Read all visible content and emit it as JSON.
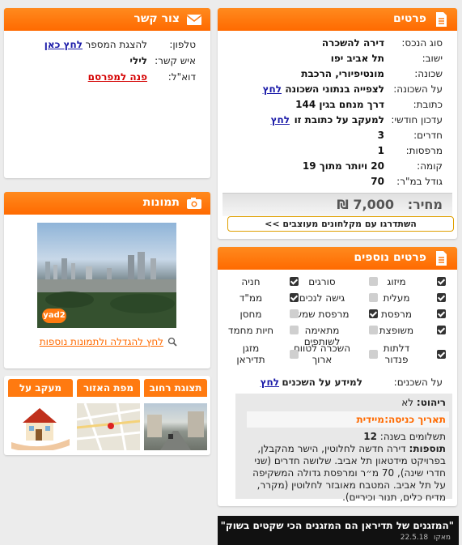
{
  "details": {
    "title": "פרטים",
    "rows": [
      {
        "label": "סוג הנכס:",
        "value": "דירה להשכרה"
      },
      {
        "label": "ישוב:",
        "value": "תל אביב יפו"
      },
      {
        "label": "שכונה:",
        "value": "מונטיפיורי, הרכבת"
      },
      {
        "label": "על השכונה:",
        "value": "לצפייה בנתוני השכונה",
        "link": "לחץ"
      },
      {
        "label": "כתובת:",
        "value": "דרך מנחם בגין 144"
      },
      {
        "label": "עדכון חודשי:",
        "value": "למעקב על כתובת זו",
        "link": "לחץ"
      },
      {
        "label": "חדרים:",
        "value": "3"
      },
      {
        "label": "מרפסות:",
        "value": "1"
      },
      {
        "label": "קומה:",
        "value": "20 ויותר מתוך 19"
      },
      {
        "label": "גודל במ\"ר:",
        "value": "70"
      }
    ],
    "price_label": "מחיר:",
    "price_value": "7,000 ₪",
    "upgrade_button": "השתדרגו עם מקלחונים מעוצבים >>"
  },
  "contact": {
    "title": "צור קשר",
    "phone_label": "טלפון:",
    "phone_text": "להצגת המספר",
    "phone_link": "לחץ כאן",
    "person_label": "איש קשר:",
    "person_value": "לילי",
    "email_label": "דוא\"ל:",
    "email_link": "פנה למפרסם"
  },
  "photos": {
    "title": "תמונות",
    "watermark": "yad2",
    "enlarge_link": "לחץ להגדלה ולתמונות נוספות"
  },
  "tabs": [
    {
      "label": "תצוגת רחוב"
    },
    {
      "label": "מפת האזור"
    },
    {
      "label": "מעקב על הבית"
    }
  ],
  "extra": {
    "title": "פרטים נוספים",
    "features": [
      [
        {
          "label": "מיזוג",
          "checked": true
        },
        {
          "label": "סורגים",
          "checked": false
        },
        {
          "label": "חניה",
          "checked": true
        }
      ],
      [
        {
          "label": "מעלית",
          "checked": true
        },
        {
          "label": "גישה לנכים",
          "checked": false
        },
        {
          "label": "ממ\"ד",
          "checked": true
        }
      ],
      [
        {
          "label": "מרפסת",
          "checked": true
        },
        {
          "label": "מרפסת שמש",
          "checked": true
        },
        {
          "label": "מחסן",
          "checked": false
        }
      ],
      [
        {
          "label": "משופצת",
          "checked": true
        },
        {
          "label": "מתאימה לשותפים",
          "checked": false
        },
        {
          "label": "חיות מחמד",
          "checked": false
        }
      ],
      [
        {
          "label": "דלתות פנדור",
          "checked": true
        },
        {
          "label": "השכרה לטווח ארוך",
          "checked": false
        },
        {
          "label": "מזגן תדיראן",
          "checked": false
        }
      ]
    ],
    "tenants_label": "על השכנים:",
    "tenants_text": "למידע על השכנים",
    "tenants_link": "לחץ",
    "furniture_label": "ריהוט:",
    "furniture_value": "לא",
    "entry_label": "תאריך כניסה:",
    "entry_value": "מיידית",
    "payments_label": "תשלומים בשנה:",
    "payments_value": "12",
    "additions_label": "תוספות:",
    "additions_text": "דירה חדשה לחלוטין, הישר מהקבלן, בפרויקט מידטאון תל אביב. שלושה חדרים (שני חדרי שינה), 70 מ״ר ומרפסת גדולה המשקיפה על תל אביב. המטבח מאובזר לחלוטין (מקרר, מדיח כלים, תנור וכיריים)."
  },
  "ad": {
    "headline": "\"המזגנים של תדיראן הם המזגנים הכי שקטים בשוק\"",
    "date": "22.5.18",
    "source": "מאקו"
  }
}
